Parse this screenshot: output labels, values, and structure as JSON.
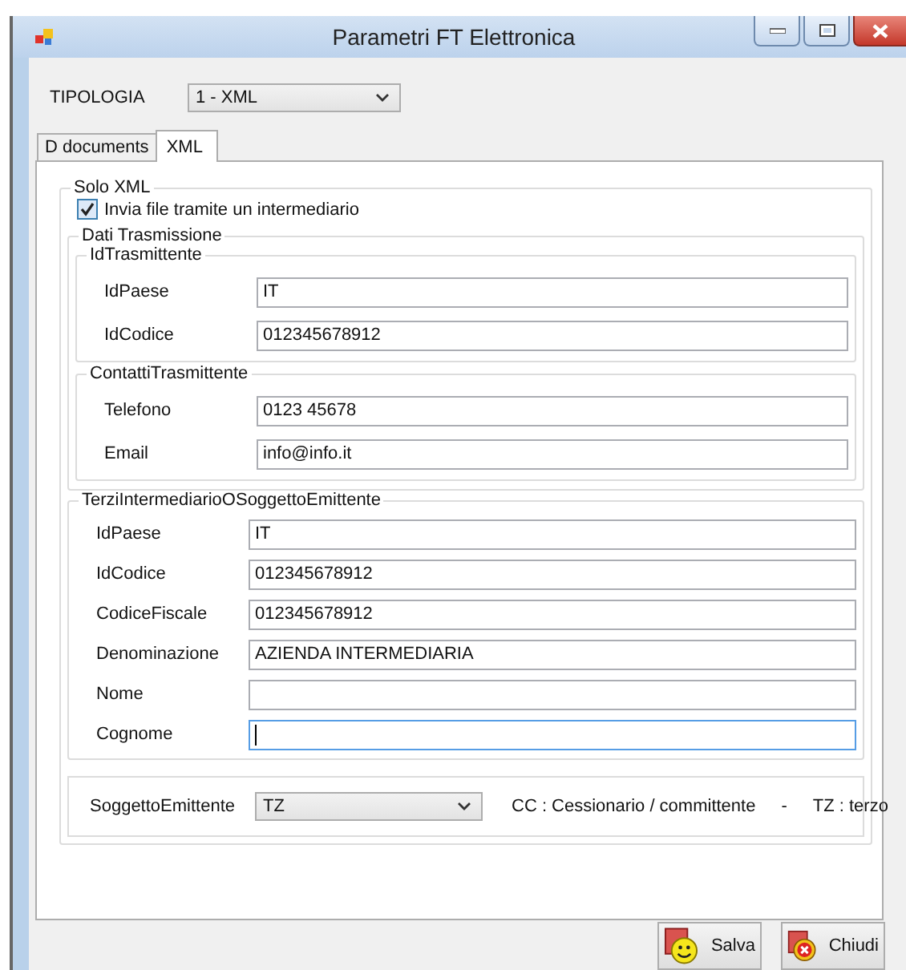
{
  "window": {
    "title": "Parametri FT Elettronica"
  },
  "tipologia": {
    "label": "TIPOLOGIA",
    "value": "1 - XML"
  },
  "tabs": [
    {
      "label": "D documents",
      "selected": false
    },
    {
      "label": "XML",
      "selected": true
    }
  ],
  "solo_xml": {
    "title": "Solo XML",
    "checkbox": {
      "label": "Invia file tramite un intermediario",
      "checked": true
    },
    "dati_trasmissione": {
      "title": "Dati Trasmissione",
      "groups": [
        {
          "title": "IdTrasmittente",
          "fields": [
            {
              "label": "IdPaese",
              "value": "IT",
              "focused": false
            },
            {
              "label": "IdCodice",
              "value": "012345678912",
              "focused": false
            }
          ]
        },
        {
          "title": "ContattiTrasmittente",
          "fields": [
            {
              "label": "Telefono",
              "value": "0123 45678",
              "focused": false
            },
            {
              "label": "Email",
              "value": "info@info.it",
              "focused": false
            }
          ]
        }
      ]
    },
    "terzi": {
      "title": "TerziIntermediarioOSoggettoEmittente",
      "fields": [
        {
          "label": "IdPaese",
          "value": "IT",
          "focused": false
        },
        {
          "label": "IdCodice",
          "value": "012345678912",
          "focused": false
        },
        {
          "label": "CodiceFiscale",
          "value": "012345678912",
          "focused": false
        },
        {
          "label": "Denominazione",
          "value": "AZIENDA INTERMEDIARIA",
          "focused": false
        },
        {
          "label": "Nome",
          "focused": false
        },
        {
          "label": "Cognome",
          "focused": true
        }
      ]
    },
    "soggetto": {
      "label": "SoggettoEmittente",
      "value": "TZ",
      "legend": [
        "CC :  Cessionario / committente",
        "-",
        "TZ : terzo"
      ]
    }
  },
  "buttons": [
    {
      "label": "Salva",
      "kind": "save"
    },
    {
      "label": "Chiudi",
      "kind": "close"
    }
  ]
}
